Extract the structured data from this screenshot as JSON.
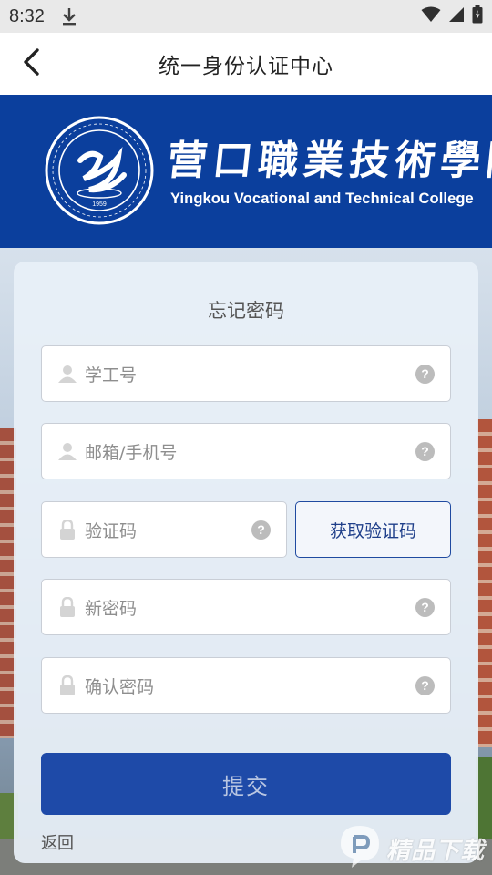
{
  "status_bar": {
    "time": "8:32",
    "icons": [
      "download-icon",
      "wifi-icon",
      "signal-icon",
      "battery-icon"
    ]
  },
  "header": {
    "title": "统一身份认证中心",
    "back_icon": "chevron-left-icon"
  },
  "banner": {
    "name_cn": "营口職業技術學院",
    "name_en": "Yingkou Vocational and Technical College",
    "emblem_year": "1959",
    "background_color": "#0b3f9d"
  },
  "form": {
    "title": "忘记密码",
    "fields": [
      {
        "placeholder": "学工号",
        "icon": "user-icon"
      },
      {
        "placeholder": "邮箱/手机号",
        "icon": "user-icon"
      },
      {
        "placeholder": "验证码",
        "icon": "lock-icon"
      },
      {
        "placeholder": "新密码",
        "icon": "lock-icon"
      },
      {
        "placeholder": "确认密码",
        "icon": "lock-icon"
      }
    ],
    "help_glyph": "?",
    "get_code_label": "获取验证码",
    "submit_label": "提交",
    "back_label": "返回"
  },
  "watermark": {
    "text": "精品下载"
  },
  "colors": {
    "primary": "#1e4aa8",
    "header_bg": "#ffffff",
    "card_bg": "#e8f0f8"
  }
}
